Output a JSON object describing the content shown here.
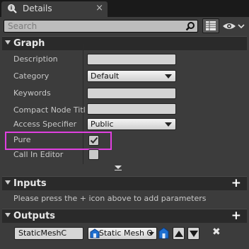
{
  "tab": {
    "title": "Details",
    "close": "×"
  },
  "search": {
    "placeholder": "Search"
  },
  "graph": {
    "title": "Graph",
    "rows": [
      {
        "label": "Description",
        "value": ""
      },
      {
        "label": "Category",
        "value": "Default"
      },
      {
        "label": "Keywords",
        "value": ""
      },
      {
        "label": "Compact Node Title",
        "value": ""
      },
      {
        "label": "Access Specifier",
        "value": "Public"
      },
      {
        "label": "Pure",
        "checked": true
      },
      {
        "label": "Call In Editor",
        "checked": false
      }
    ]
  },
  "inputs": {
    "title": "Inputs",
    "add": "+",
    "message": "Please press the + icon above to add parameters"
  },
  "outputs": {
    "title": "Outputs",
    "add": "+",
    "param": {
      "name": "StaticMeshC",
      "type": "Static Mesh O"
    },
    "delete": "✖"
  },
  "colors": {
    "highlight": "#e040e0",
    "panel": "#3c3c3c",
    "header": "#2a2a2a"
  }
}
